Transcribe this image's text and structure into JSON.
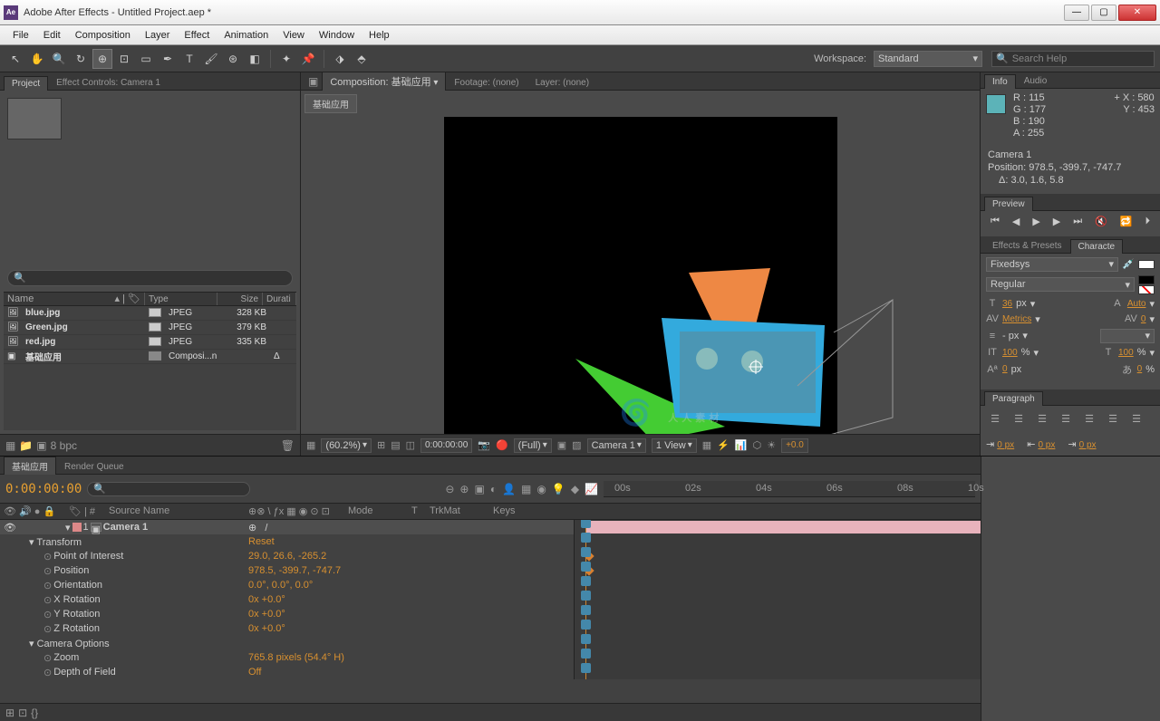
{
  "title": "Adobe After Effects - Untitled Project.aep *",
  "menu": [
    "File",
    "Edit",
    "Composition",
    "Layer",
    "Effect",
    "Animation",
    "View",
    "Window",
    "Help"
  ],
  "workspace": {
    "label": "Workspace:",
    "value": "Standard"
  },
  "search_help": "Search Help",
  "project": {
    "tab": "Project",
    "effect_tab": "Effect Controls: Camera 1",
    "headers": {
      "name": "Name",
      "type": "Type",
      "size": "Size",
      "dur": "Durati"
    },
    "items": [
      {
        "name": "blue.jpg",
        "type": "JPEG",
        "size": "328 KB",
        "dur": ""
      },
      {
        "name": "Green.jpg",
        "type": "JPEG",
        "size": "379 KB",
        "dur": ""
      },
      {
        "name": "red.jpg",
        "type": "JPEG",
        "size": "335 KB",
        "dur": ""
      },
      {
        "name": "基础应用",
        "type": "Composi...n",
        "size": "",
        "dur": "Δ"
      }
    ],
    "bpc": "8 bpc"
  },
  "comp": {
    "tab": "Composition: 基础应用",
    "footage_tab": "Footage: (none)",
    "layer_tab": "Layer: (none)",
    "chip": "基础应用",
    "zoom": "(60.2%)",
    "timecode": "0:00:00:00",
    "res": "(Full)",
    "camera": "Camera 1",
    "views": "1 View",
    "px_offset": "+0.0"
  },
  "info": {
    "tab": "Info",
    "audio_tab": "Audio",
    "r": "R : 115",
    "g": "G : 177",
    "b": "B : 190",
    "a": "A : 255",
    "x": "X : 580",
    "y": "Y : 453",
    "layer": "Camera 1",
    "pos": "Position: 978.5, -399.7, -747.7",
    "delta": "Δ: 3.0, 1.6, 5.8"
  },
  "preview": {
    "tab": "Preview"
  },
  "effects_tab": "Effects & Presets",
  "character": {
    "tab": "Characte",
    "font": "Fixedsys",
    "style": "Regular",
    "size": "36",
    "size_unit": "px",
    "leading": "Auto",
    "kerning": "Metrics",
    "tracking": "0",
    "stroke": "- px",
    "vscale": "100",
    "vscale_unit": "%",
    "hscale": "100",
    "hscale_unit": "%",
    "baseline": "0",
    "baseline_unit": "px",
    "tsume": "0",
    "tsume_unit": "%"
  },
  "paragraph": {
    "tab": "Paragraph",
    "indent": "0 px"
  },
  "timeline": {
    "tab": "基础应用",
    "rq_tab": "Render Queue",
    "time": "0:00:00:00",
    "cols": {
      "source": "Source Name",
      "mode": "Mode",
      "trkmat": "TrkMat",
      "keys": "Keys",
      "t": "T"
    },
    "ruler": [
      "00s",
      "02s",
      "04s",
      "06s",
      "08s",
      "10s"
    ],
    "layer": {
      "num": "1",
      "name": "Camera 1"
    },
    "props": [
      {
        "name": "Transform",
        "val": "Reset",
        "indent": 1,
        "arrow": true
      },
      {
        "name": "Point of Interest",
        "val": "29.0, 26.6, -265.2",
        "indent": 2,
        "kf": true,
        "sw": true
      },
      {
        "name": "Position",
        "val": "978.5, -399.7, -747.7",
        "indent": 2,
        "kf": true,
        "sw": true
      },
      {
        "name": "Orientation",
        "val": "0.0°, 0.0°, 0.0°",
        "indent": 2,
        "sw": true
      },
      {
        "name": "X Rotation",
        "val": "0x +0.0°",
        "indent": 2,
        "sw": true
      },
      {
        "name": "Y Rotation",
        "val": "0x +0.0°",
        "indent": 2,
        "sw": true
      },
      {
        "name": "Z Rotation",
        "val": "0x +0.0°",
        "indent": 2,
        "sw": true
      },
      {
        "name": "Camera Options",
        "val": "",
        "indent": 1,
        "arrow": true
      },
      {
        "name": "Zoom",
        "val": "765.8 pixels (54.4° H)",
        "indent": 2,
        "sw": true
      },
      {
        "name": "Depth of Field",
        "val": "Off",
        "indent": 2,
        "sw": true
      }
    ]
  },
  "watermark": "人人素材"
}
